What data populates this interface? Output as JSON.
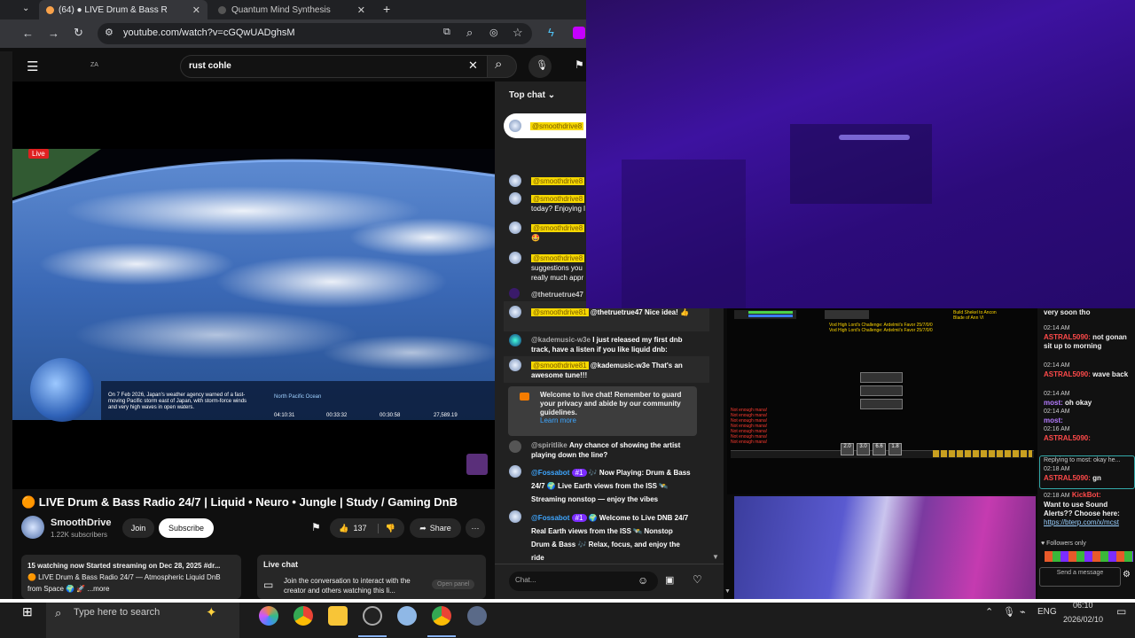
{
  "browser": {
    "tabs": [
      {
        "label": "(64) ● LIVE Drum & Bass R",
        "active": true
      },
      {
        "label": "Quantum Mind Synthesis",
        "active": false
      }
    ],
    "url": "youtube.com/watch?v=cGQwUADghsM"
  },
  "youtube": {
    "search_value": "rust cohle",
    "live_badge": "Live",
    "video_overlay_text": "On 7 Feb 2026, Japan's weather agency warned of a fast-moving Pacific storm east of Japan, with storm-force winds and very high waves in open waters.",
    "overlay_region": "North Pacific Ocean",
    "overlay_times": [
      "04:10:31",
      "00:33:32",
      "00:30:58",
      "27,589.19"
    ],
    "video_title": "🟠 LIVE Drum & Bass Radio 24/7 | Liquid • Neuro • Jungle | Study / Gaming DnB",
    "channel_name": "SmoothDrive",
    "subscribers": "1.22K subscribers",
    "join_label": "Join",
    "subscribe_label": "Subscribe",
    "likes": "137",
    "share_label": "Share",
    "description_line1": "15 watching now  Started streaming on Dec 28, 2025  #dr...",
    "description_line2": "🟠 LIVE Drum & Bass Radio 24/7 — Atmospheric Liquid DnB",
    "description_line3": "from Space 🌍 🚀 ...more",
    "livechat_title": "Live chat",
    "livechat_text": "Join the conversation to interact with the creator and others watching this li...",
    "open_panel": "Open panel"
  },
  "chat": {
    "header": "Top chat",
    "pinned_name": "@smoothdrive8",
    "messages": [
      {
        "name": "@smoothdrive8",
        "text": ""
      },
      {
        "name": "@smoothdrive8",
        "text": "today? Enjoying l"
      },
      {
        "name": "@smoothdrive8",
        "text": "🤩"
      },
      {
        "name": "@smoothdrive8",
        "text": "suggestions you really much appr"
      },
      {
        "name": "@thetruetrue47",
        "text": ""
      },
      {
        "name": "@smoothdrive81",
        "text": "@thetruetrue47 Nice idea! 👍"
      },
      {
        "name": "@kademusic-w3e",
        "text": "I just released my first dnb track, have a listen if you like liquid dnb:"
      },
      {
        "name": "@smoothdrive81",
        "text": "@kademusic-w3e That's an awesome tune!!!"
      }
    ],
    "welcome": "Welcome to live chat! Remember to guard your privacy and abide by our community guidelines.",
    "learn_more": "Learn more",
    "spirit_name": "@spiritlike",
    "spirit_text": "Any chance of showing the artist playing down the line?",
    "bot1_name": "@Fossabot",
    "bot1_badge": "#1",
    "bot1_text": "🎶 Now Playing: Drum & Bass 24/7 🌍 Live Earth views from the ISS 🛰️ Streaming nonstop — enjoy the vibes",
    "bot2_name": "@Fossabot",
    "bot2_badge": "#1",
    "bot2_text": "🌍 Welcome to Live DNB 24/7 Real Earth views from the ISS 🛰️ Nonstop Drum & Bass 🎶 Relax, focus, and enjoy the ride",
    "input_placeholder": "Chat..."
  },
  "twitch": {
    "top_text": "very soon tho",
    "lines": [
      {
        "time": "02:14 AM",
        "name": "ASTRAL5090:",
        "text": "not gonan sit up to morning"
      },
      {
        "time": "02:14 AM",
        "name": "ASTRAL5090:",
        "text": "wave back"
      },
      {
        "time": "02:14 AM",
        "name": "most:",
        "text": "oh okay"
      },
      {
        "time": "02:14 AM",
        "name": "most:",
        "text": ""
      },
      {
        "time": "02:16 AM",
        "name": "ASTRAL5090:",
        "text": ""
      },
      {
        "time": "",
        "name": "",
        "text": "Replying to most: okay he..."
      },
      {
        "time": "02:18 AM",
        "name": "ASTRAL5090:",
        "text": "gn"
      },
      {
        "time": "02:18 AM",
        "name": "KickBot:",
        "text": "Want to use Sound Alerts?? Choose here:"
      },
      {
        "time": "",
        "name": "",
        "text": "https://bterp.com/x/mcst"
      }
    ],
    "followers_only": "Followers only",
    "send_message": "Send a message"
  },
  "game": {
    "quest1": "Vod High Lord's Challenge: Ardelmii's Favor 25/7/0/0",
    "quest2": "Vod High Lord's Challenge: Ardelmii's Favor 25/7/0/0",
    "boss_text": "Build Shekel to Ancon Blade of Ann VI",
    "err": "Not enough mana!",
    "hotbar": [
      "2.0",
      "3.0",
      "6.6",
      "1.8"
    ]
  },
  "taskbar": {
    "search_placeholder": "Type here to search",
    "lang": "ENG",
    "time": "06:10",
    "date": "2026/02/10"
  },
  "colors": {
    "youtube_bg": "#0f0f0f",
    "chat_bg": "#212121",
    "yellow_badge": "#f6d800",
    "purple_panel": "#3d12a0",
    "link_blue": "#3ea6ff"
  }
}
